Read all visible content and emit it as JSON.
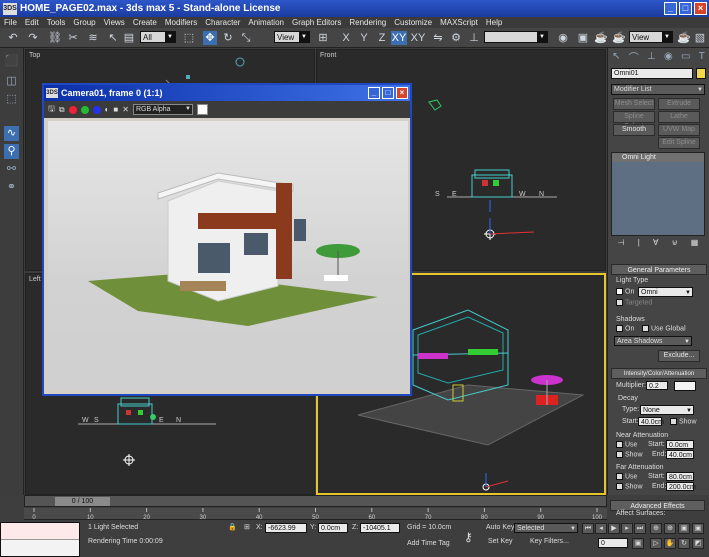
{
  "window": {
    "title": "HOME_PAGE02.max - 3ds max 5 - Stand-alone License",
    "icon_text": "3DS",
    "buttons": [
      "_",
      "□",
      "×"
    ]
  },
  "menu": [
    "File",
    "Edit",
    "Tools",
    "Group",
    "Views",
    "Create",
    "Modifiers",
    "Character",
    "Animation",
    "Graph Editors",
    "Rendering",
    "Customize",
    "MAXScript",
    "Help"
  ],
  "toolbar": {
    "selection_filter": "All",
    "ref_coord": "View",
    "axis_labels": [
      "X",
      "Y",
      "Z",
      "XY",
      "XY"
    ],
    "named_selection": "",
    "view_drop": "View"
  },
  "viewports": {
    "top": "Top",
    "front": "Front",
    "left": "Left",
    "perspective": ""
  },
  "front_axis_labels": [
    "S",
    "E",
    "W",
    "N"
  ],
  "left_axis_labels": [
    "W",
    "S",
    "E",
    "N"
  ],
  "render_window": {
    "title": "Camera01, frame 0 (1:1)",
    "channel": "RGB Alpha",
    "icon_text": "3DS"
  },
  "command_panel": {
    "object_name": "Omni01",
    "object_color": "#f2d84a",
    "modifier_list": "Modifier List",
    "buttons": [
      "Mesh Select",
      "Extrude",
      "Spline Select",
      "Lathe",
      "Smooth",
      "UVW Map",
      "Edit Spline"
    ],
    "stack_item": "Omni Light",
    "general_parameters": "General Parameters",
    "light_type": "Light Type",
    "on_label": "On",
    "light_type_value": "Omni",
    "targeted": "Targeted",
    "shadows": "Shadows",
    "use_global": "Use Global",
    "shadow_type": "Area Shadows",
    "exclude": "Exclude...",
    "intensity_rollout": "Intensity/Color/Attenuation",
    "multiplier_label": "Multiplier:",
    "multiplier": "0.2",
    "decay": "Decay",
    "type_label": "Type:",
    "decay_type": "None",
    "start_label": "Start:",
    "decay_start": "40.0cm",
    "show": "Show",
    "near_atten": "Near Attenuation",
    "use": "Use",
    "near_start": "0.0cm",
    "near_end": "40.0cm",
    "end_label": "End:",
    "far_atten": "Far Attenuation",
    "far_start": "80.0cm",
    "far_end": "200.0cm",
    "advanced": "Advanced Effects",
    "affect_surfaces": "Affect Surfaces:"
  },
  "timeline": {
    "frame": "0 / 100",
    "ticks": [
      "0",
      "10",
      "20",
      "30",
      "40",
      "50",
      "60",
      "70",
      "80",
      "90",
      "100"
    ]
  },
  "status": {
    "selected": "1 Light Selected",
    "render_time": "Rendering Time 0:00:09",
    "x_label": "X:",
    "x": "-6623.99",
    "y_label": "Y:",
    "y": "0.0cm",
    "z_label": "Z:",
    "z": "-10405.1",
    "grid": "Grid = 10.0cm",
    "add_time_tag": "Add Time Tag",
    "auto_key": "Auto Key",
    "auto_key_value": "Selected",
    "set_key": "Set Key",
    "key_filters": "Key Filters...",
    "frame_field": "0"
  }
}
